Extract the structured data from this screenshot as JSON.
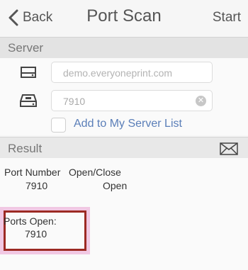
{
  "nav": {
    "back_label": "Back",
    "title": "Port Scan",
    "start_label": "Start"
  },
  "server": {
    "section_label": "Server",
    "host_placeholder": "demo.everyoneprint.com",
    "port_value": "7910",
    "add_to_list_label": "Add to My Server List",
    "add_to_list_checked": false
  },
  "result": {
    "section_label": "Result",
    "col_port_header": "Port Number",
    "col_status_header": "Open/Close",
    "rows": [
      {
        "port": "7910",
        "status": "Open"
      }
    ],
    "ports_open_label": "Ports Open:",
    "ports_open_value": "7910"
  },
  "colors": {
    "link_blue": "#5a7eb8",
    "highlight_border": "#9c2a24",
    "highlight_halo": "#f1c8e3"
  }
}
